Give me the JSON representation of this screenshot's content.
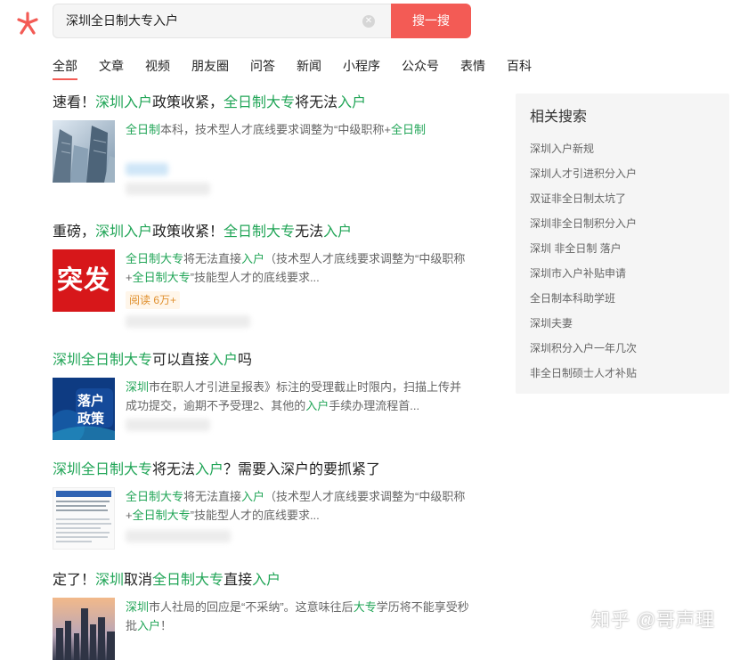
{
  "search": {
    "query": "深圳全日制大专入户",
    "button_label": "搜一搜"
  },
  "tabs": [
    {
      "label": "全部"
    },
    {
      "label": "文章"
    },
    {
      "label": "视频"
    },
    {
      "label": "朋友圈"
    },
    {
      "label": "问答"
    },
    {
      "label": "新闻"
    },
    {
      "label": "小程序"
    },
    {
      "label": "公众号"
    },
    {
      "label": "表情"
    },
    {
      "label": "百科"
    }
  ],
  "results": [
    {
      "title": [
        {
          "t": "速看！"
        },
        {
          "t": "深圳入户",
          "hl": true
        },
        {
          "t": "政策收紧，"
        },
        {
          "t": "全日制大专",
          "hl": true
        },
        {
          "t": "将无法"
        },
        {
          "t": "入户",
          "hl": true
        }
      ],
      "snippet": [
        {
          "t": "全日制",
          "hl": true
        },
        {
          "t": "本科，技术型人才底线要求调整为“中级职称+"
        },
        {
          "t": "全日制",
          "hl": true
        }
      ]
    },
    {
      "title": [
        {
          "t": "重磅，"
        },
        {
          "t": "深圳入户",
          "hl": true
        },
        {
          "t": "政策收紧！"
        },
        {
          "t": "全日制大专",
          "hl": true
        },
        {
          "t": "无法"
        },
        {
          "t": "入户",
          "hl": true
        }
      ],
      "thumb_text": "突发",
      "snippet": [
        {
          "t": "全日制大专",
          "hl": true
        },
        {
          "t": "将无法直接"
        },
        {
          "t": "入户",
          "hl": true
        },
        {
          "t": "（技术型人才底线要求调整为“中级职称+"
        },
        {
          "t": "全日制大专",
          "hl": true
        },
        {
          "t": "”技能型人才的底线要求..."
        }
      ],
      "read_count": "阅读 6万+"
    },
    {
      "title": [
        {
          "t": "深圳全日制大专",
          "hl": true
        },
        {
          "t": "可以直接"
        },
        {
          "t": "入户",
          "hl": true
        },
        {
          "t": "吗"
        }
      ],
      "thumb_text_1": "落户",
      "thumb_text_2": "政策",
      "snippet": [
        {
          "t": "深圳",
          "hl": true
        },
        {
          "t": "市在职人才引进呈报表》标注的受理截止时限内，扫描上传并成功提交，逾期不予受理2、其他的"
        },
        {
          "t": "入户",
          "hl": true
        },
        {
          "t": "手续办理流程首..."
        }
      ]
    },
    {
      "title": [
        {
          "t": "深圳全日制大专",
          "hl": true
        },
        {
          "t": "将无法"
        },
        {
          "t": "入户",
          "hl": true
        },
        {
          "t": "？需要入深户的要抓紧了"
        }
      ],
      "snippet": [
        {
          "t": "全日制大专",
          "hl": true
        },
        {
          "t": "将无法直接"
        },
        {
          "t": "入户",
          "hl": true
        },
        {
          "t": "（技术型人才底线要求调整为“中级职称+"
        },
        {
          "t": "全日制大专",
          "hl": true
        },
        {
          "t": "”技能型人才的底线要求..."
        }
      ]
    },
    {
      "title": [
        {
          "t": "定了！"
        },
        {
          "t": "深圳",
          "hl": true
        },
        {
          "t": "取消"
        },
        {
          "t": "全日制大专",
          "hl": true
        },
        {
          "t": "直接"
        },
        {
          "t": "入户",
          "hl": true
        }
      ],
      "snippet": [
        {
          "t": "深圳",
          "hl": true
        },
        {
          "t": "市人社局的回应是“不采纳”。这意味往后"
        },
        {
          "t": "大专",
          "hl": true
        },
        {
          "t": "学历将不能享受秒批"
        },
        {
          "t": "入户",
          "hl": true
        },
        {
          "t": "！"
        }
      ]
    }
  ],
  "related": {
    "title": "相关搜索",
    "items": [
      "深圳入户新规",
      "深圳人才引进积分入户",
      "双证非全日制太坑了",
      "深圳非全日制积分入户",
      "深圳 非全日制 落户",
      "深圳市入户补贴申请",
      "全日制本科助学班",
      "深圳夫妻",
      "深圳积分入户一年几次",
      "非全日制硕士人才补贴"
    ]
  },
  "watermark": "知乎 @哥声理",
  "colors": {
    "accent": "#f35b55",
    "highlight": "#21a557",
    "panel": "#f5f5f5"
  },
  "icons": {
    "logo": "wechat-search-logo-icon",
    "clear": "clear-circle-icon"
  }
}
